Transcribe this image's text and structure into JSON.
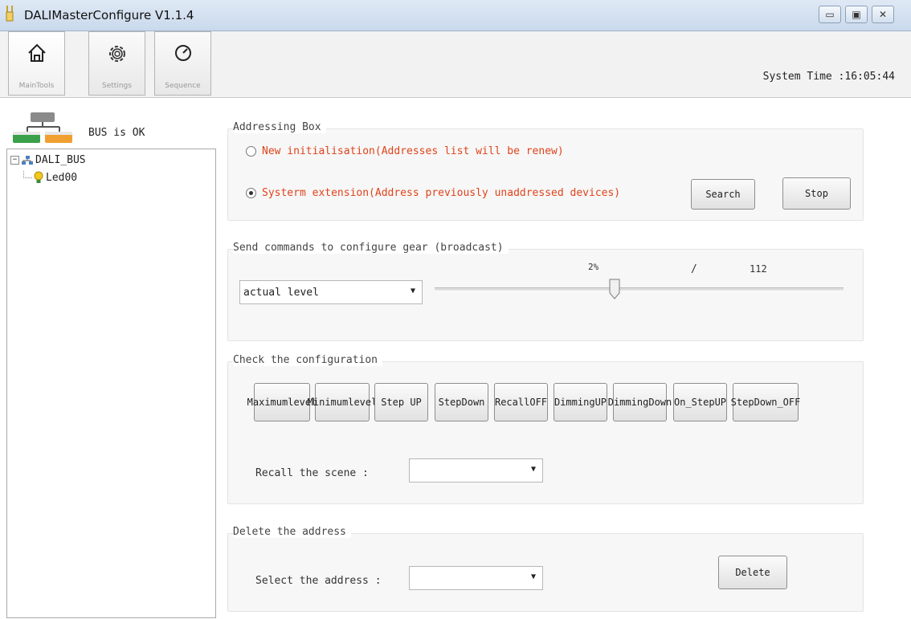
{
  "window": {
    "title": "DALIMasterConfigure V1.1.4",
    "controls": [
      "minimize-icon",
      "maximize-icon",
      "close-icon"
    ]
  },
  "toolbar": {
    "tools": [
      {
        "label": "MainTools",
        "icon": "home-icon"
      },
      {
        "label": "Settings",
        "icon": "gear-icon"
      },
      {
        "label": "Sequence",
        "icon": "clock-icon"
      }
    ],
    "system_time": "System Time :16:05:44"
  },
  "left_panel": {
    "bus_status": "BUS is OK",
    "tree": {
      "root": "DALI_BUS",
      "children": [
        "Led00"
      ]
    }
  },
  "addressing": {
    "title": "Addressing Box",
    "option_new": "New initialisation(Addresses list will be renew)",
    "option_extend": "Systerm extension(Address previously unaddressed devices)",
    "selected": "option_extend",
    "search_label": "Search",
    "stop_label": "Stop"
  },
  "commands": {
    "title": "Send commands to configure gear (broadcast)",
    "select_value": "actual level",
    "percent": "2%",
    "separator": "/",
    "level": "112",
    "slider_fraction": 0.44
  },
  "check": {
    "title": "Check the configuration",
    "buttons": [
      {
        "l1": "Maximum",
        "l2": "level"
      },
      {
        "l1": "Minimum",
        "l2": "level"
      },
      {
        "l1": "Step UP",
        "l2": ""
      },
      {
        "l1": "Step",
        "l2": "Down"
      },
      {
        "l1": "Recall",
        "l2": "OFF"
      },
      {
        "l1": "Dimming",
        "l2": "UP"
      },
      {
        "l1": "Dimming",
        "l2": "Down"
      },
      {
        "l1": "On_Step",
        "l2": "UP"
      },
      {
        "l1": "Step",
        "l2": "Down_OFF"
      }
    ],
    "scene_label": "Recall the scene :",
    "scene_value": ""
  },
  "delete": {
    "title": "Delete the  address",
    "select_label": "Select the address :",
    "select_value": "",
    "delete_label": "Delete"
  },
  "colors": {
    "radio_text": "#e0431b",
    "bus_green": "#3aa04a",
    "bus_orange": "#f0a030",
    "bus_gray": "#8a8a8a"
  }
}
